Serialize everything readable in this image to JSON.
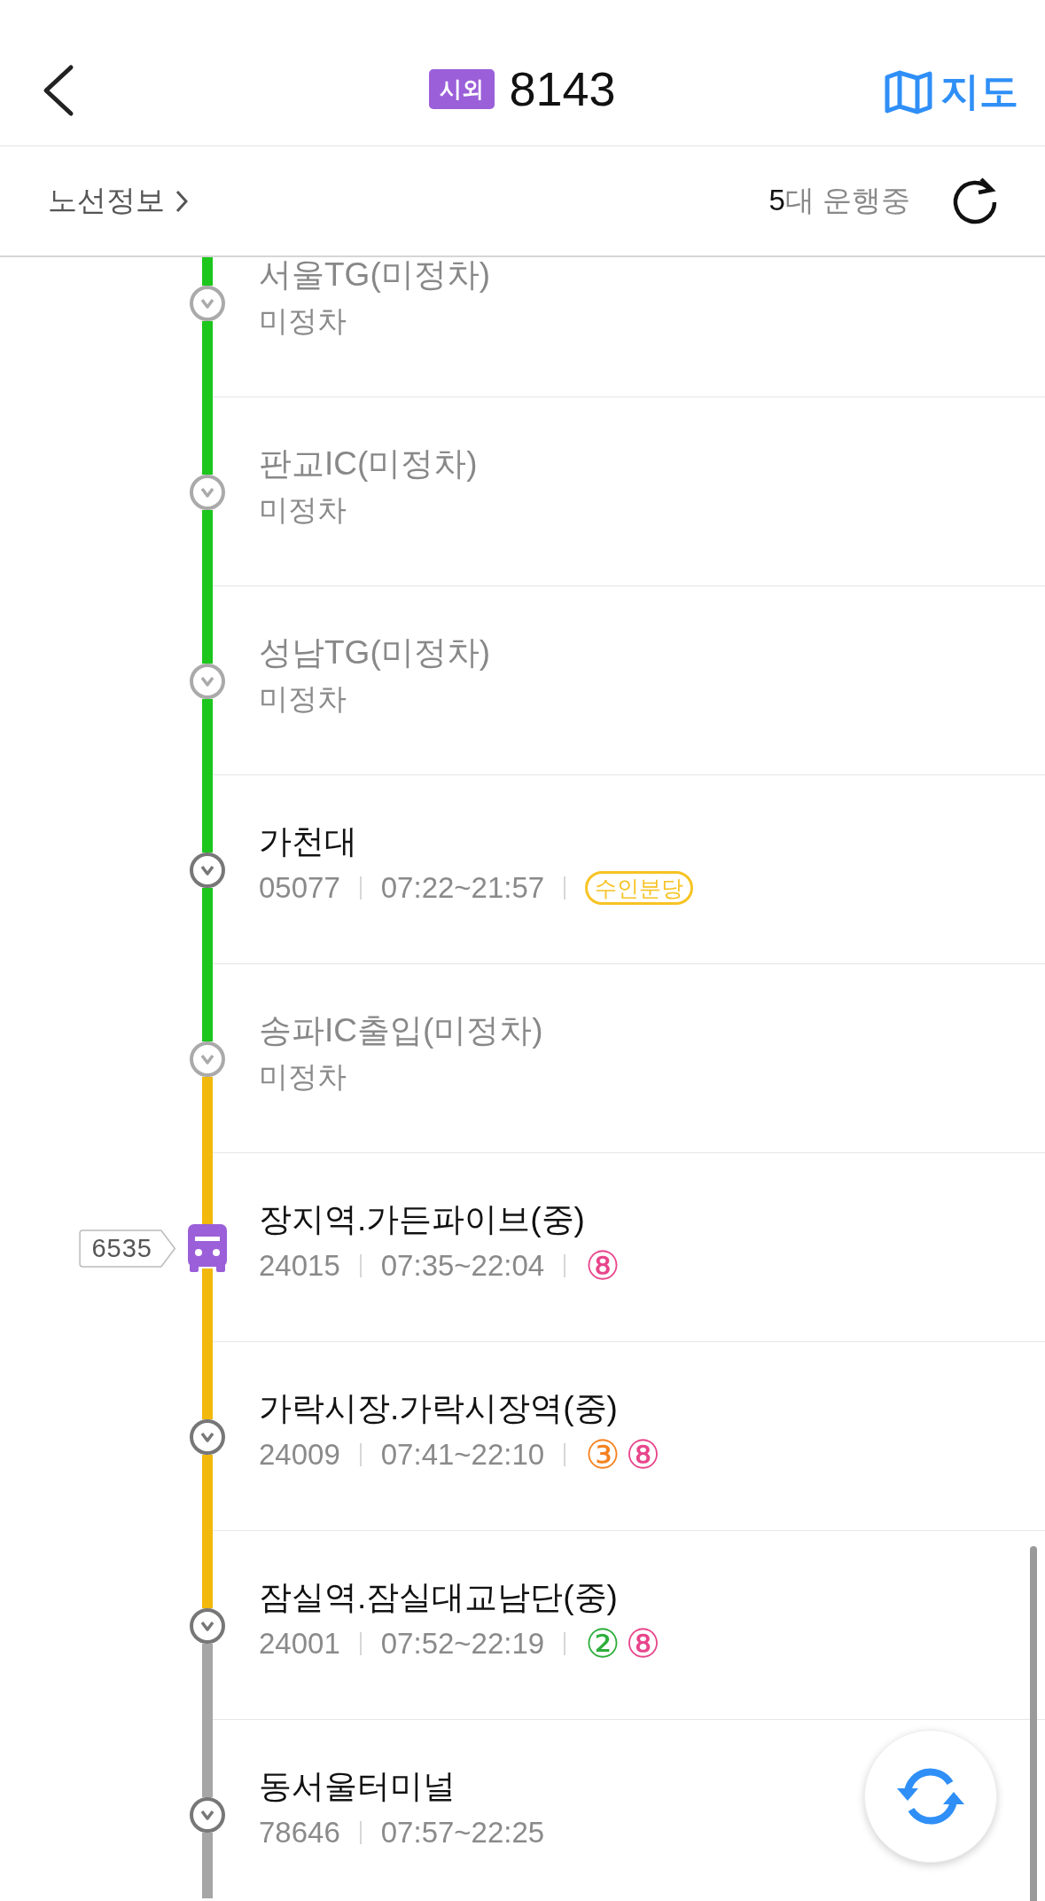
{
  "header": {
    "badge": "시외",
    "title": "8143",
    "map_button": "지도"
  },
  "route_bar": {
    "info_link": "노선정보",
    "running_count": "5",
    "running_label": "대 운행중"
  },
  "stops": [
    {
      "kind": "nonstop",
      "name": "서울TG(미정차)",
      "note": "미정차",
      "color": "#1cc61c"
    },
    {
      "kind": "nonstop",
      "name": "판교IC(미정차)",
      "note": "미정차",
      "color": "#1cc61c"
    },
    {
      "kind": "nonstop",
      "name": "성남TG(미정차)",
      "note": "미정차",
      "color": "#1cc61c"
    },
    {
      "kind": "stop",
      "name": "가천대",
      "id": "05077",
      "hours": "07:22~21:57",
      "tags": [
        {
          "kind": "badge",
          "label": "수인분당",
          "color": "#f7c325"
        }
      ],
      "color": "#1cc61c"
    },
    {
      "kind": "nonstop",
      "name": "송파IC출입(미정차)",
      "note": "미정차",
      "color": "#f2b90c"
    },
    {
      "kind": "stop",
      "name": "장지역.가든파이브(중)",
      "bus": {
        "number": "6535"
      },
      "id": "24015",
      "hours": "07:35~22:04",
      "tags": [
        {
          "kind": "circle",
          "label": "⑧",
          "color": "#e8458b"
        }
      ],
      "color": "#f2b90c"
    },
    {
      "kind": "stop",
      "name": "가락시장.가락시장역(중)",
      "id": "24009",
      "hours": "07:41~22:10",
      "tags": [
        {
          "kind": "circle",
          "label": "③",
          "color": "#f58220"
        },
        {
          "kind": "circle",
          "label": "⑧",
          "color": "#e8458b"
        }
      ],
      "color": "#f2b90c"
    },
    {
      "kind": "stop",
      "name": "잠실역.잠실대교남단(중)",
      "id": "24001",
      "hours": "07:52~22:19",
      "tags": [
        {
          "kind": "circle",
          "label": "②",
          "color": "#2dae3a"
        },
        {
          "kind": "circle",
          "label": "⑧",
          "color": "#e8458b"
        }
      ],
      "color": "#a6a6a6"
    },
    {
      "kind": "stop",
      "name": "동서울터미널",
      "id": "78646",
      "hours": "07:57~22:25",
      "color": "#a6a6a6"
    }
  ]
}
